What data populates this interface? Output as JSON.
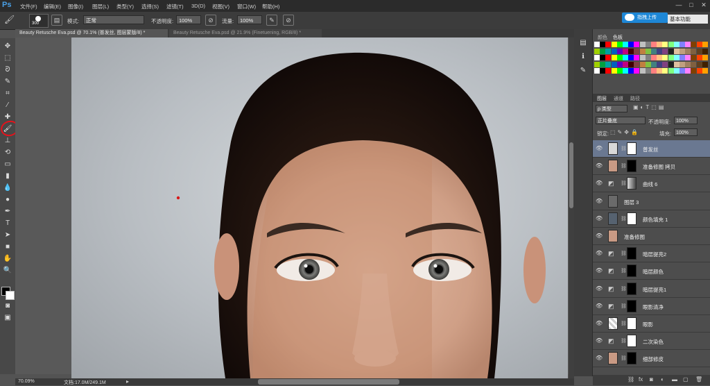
{
  "app": {
    "logo": "Ps"
  },
  "menu": [
    "文件(F)",
    "编辑(E)",
    "图像(I)",
    "图层(L)",
    "类型(Y)",
    "选择(S)",
    "滤镜(T)",
    "3D(D)",
    "视图(V)",
    "窗口(W)",
    "帮助(H)"
  ],
  "window_controls": {
    "minimize": "—",
    "maximize": "□",
    "close": "✕"
  },
  "upload_button": "指拽上传",
  "workspace": "基本功能",
  "options": {
    "brush_size": "300",
    "mode_label": "模式:",
    "mode_value": "正常",
    "opacity_label": "不透明度:",
    "opacity_value": "100%",
    "flow_label": "流量:",
    "flow_value": "100%"
  },
  "doc_tabs": [
    {
      "title": "Beauty Retusche Eva.psd @ 70.1% (普发丝, 图层蒙版/8) *",
      "close": "×"
    },
    {
      "title": "Beauty Retusche Eva.psd @ 21.9% (Finetuening, RGB/8) *",
      "close": "×"
    }
  ],
  "status": {
    "zoom": "70.09%",
    "doc": "文档:17.0M/249.1M",
    "arrow": "▸"
  },
  "color_panel": {
    "tab1": "颜色",
    "tab2": "色板"
  },
  "swatch_colors": [
    "#ffffff",
    "#000000",
    "#ff0000",
    "#ffff00",
    "#00ff00",
    "#00ffff",
    "#0000ff",
    "#ff00ff",
    "#c0c0c0",
    "#808080",
    "#ff8080",
    "#ffc080",
    "#ffff80",
    "#80ff80",
    "#80ffff",
    "#8080ff",
    "#ff80ff",
    "#804000",
    "#ff4000",
    "#ffa000",
    "#a0d000",
    "#00a040",
    "#00a0a0",
    "#0060c0",
    "#6000c0",
    "#c00080",
    "#400000",
    "#804040",
    "#c08040",
    "#80c040",
    "#408080",
    "#404080",
    "#804080",
    "#202020",
    "#e0c0a0",
    "#c0a080",
    "#a08060",
    "#806040",
    "#604020",
    "#402000"
  ],
  "layers_panel": {
    "tab_layers": "图层",
    "tab_channels": "通道",
    "tab_paths": "路径",
    "filter_kind": "ρ 类型",
    "blend_mode": "正片叠底",
    "opacity_label": "不透明度:",
    "opacity_value": "100%",
    "lock_label": "锁定:",
    "fill_label": "填充:",
    "fill_value": "100%"
  },
  "layers": [
    {
      "name": "普发丝",
      "selected": true,
      "type": "mask-white"
    },
    {
      "name": "准备修图 拷贝",
      "selected": false,
      "type": "portrait-mask"
    },
    {
      "name": "曲线 6",
      "selected": false,
      "type": "adjust-gradient"
    },
    {
      "name": "图层 3",
      "selected": false,
      "type": "plain"
    },
    {
      "name": "颜色填充 1",
      "selected": false,
      "type": "fill"
    },
    {
      "name": "准备修图",
      "selected": false,
      "type": "portrait"
    },
    {
      "name": "暗层提亮2",
      "selected": false,
      "type": "adjust-black"
    },
    {
      "name": "暗层颜色",
      "selected": false,
      "type": "adjust-black"
    },
    {
      "name": "暗层提亮1",
      "selected": false,
      "type": "adjust-black"
    },
    {
      "name": "眼影清净",
      "selected": false,
      "type": "adjust-black"
    },
    {
      "name": "眼影",
      "selected": false,
      "type": "checker-white"
    },
    {
      "name": "二次染色",
      "selected": false,
      "type": "adjust-white"
    },
    {
      "name": "细部修皮",
      "selected": false,
      "type": "portrait-mask"
    }
  ],
  "panel_tools": {
    "fx": "fx",
    "lock": "🔒",
    "trash": "🗑"
  }
}
